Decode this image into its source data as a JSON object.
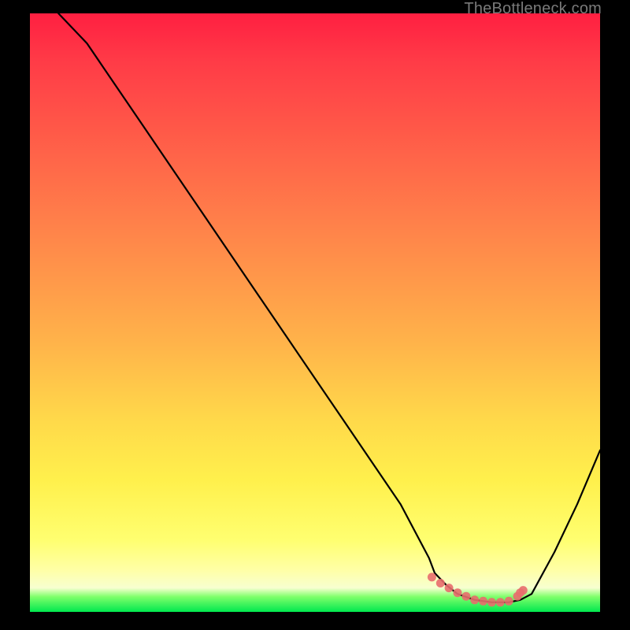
{
  "watermark": "TheBottleneck.com",
  "colors": {
    "background": "#000000",
    "gradient_top": "#ff1f41",
    "gradient_bottom": "#00e84f",
    "curve": "#000000",
    "marker": "#e86d6d"
  },
  "chart_data": {
    "type": "line",
    "title": "",
    "xlabel": "",
    "ylabel": "",
    "xlim": [
      0,
      100
    ],
    "ylim": [
      0,
      100
    ],
    "series": [
      {
        "name": "bottleneck-curve",
        "x": [
          5,
          10,
          15,
          20,
          25,
          30,
          35,
          40,
          45,
          50,
          55,
          60,
          65,
          70,
          71,
          73,
          75,
          78,
          81,
          84,
          86,
          88,
          92,
          96,
          100
        ],
        "y": [
          100,
          95,
          88,
          81,
          74,
          67,
          60,
          53,
          46,
          39,
          32,
          25,
          18,
          9,
          6.5,
          4.5,
          3,
          2,
          1.6,
          1.6,
          2,
          3,
          10,
          18,
          27
        ]
      }
    ],
    "markers": {
      "name": "valley-highlight",
      "x": [
        70.5,
        72,
        73.5,
        75,
        76.5,
        78,
        79.5,
        81,
        82.5,
        84,
        85.5,
        86,
        86.5
      ],
      "y": [
        5.8,
        4.8,
        4.0,
        3.2,
        2.6,
        2.0,
        1.8,
        1.6,
        1.6,
        1.8,
        2.6,
        3.2,
        3.6
      ]
    }
  }
}
